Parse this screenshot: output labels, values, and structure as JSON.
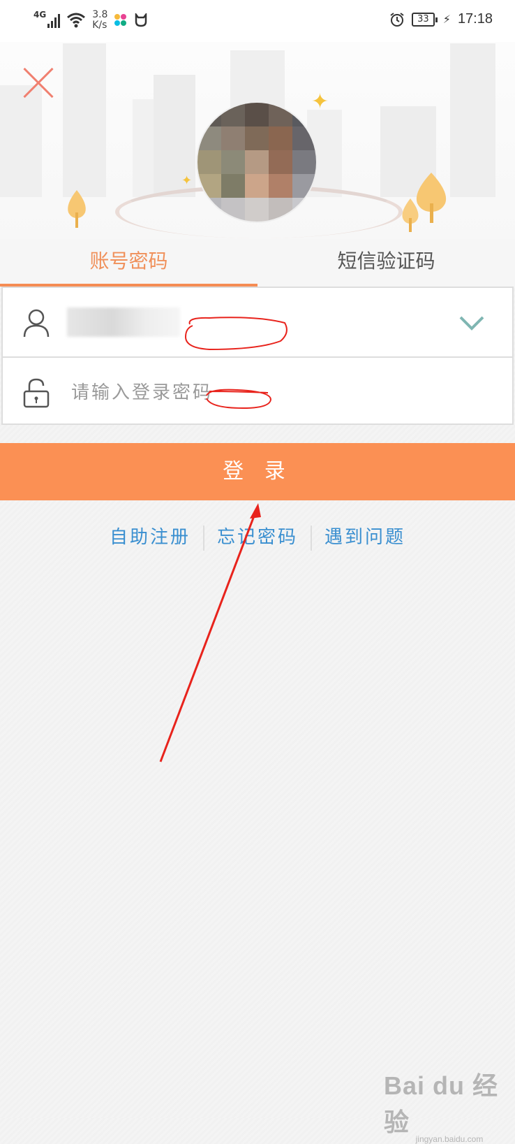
{
  "status_bar": {
    "network": "4G",
    "speed_value": "3.8",
    "speed_unit": "K/s",
    "battery": "33",
    "time": "17:18"
  },
  "tabs": [
    {
      "label": "账号密码",
      "active": true
    },
    {
      "label": "短信验证码",
      "active": false
    }
  ],
  "form": {
    "password_placeholder": "请输入登录密码"
  },
  "login_button": "登 录",
  "links": [
    "自助注册",
    "忘记密码",
    "遇到问题"
  ],
  "watermark": {
    "main": "Bai du 经验",
    "sub": "jingyan.baidu.com"
  },
  "colors": {
    "accent": "#fb9054",
    "link": "#3a8fd0",
    "annotation": "#e8231c"
  }
}
